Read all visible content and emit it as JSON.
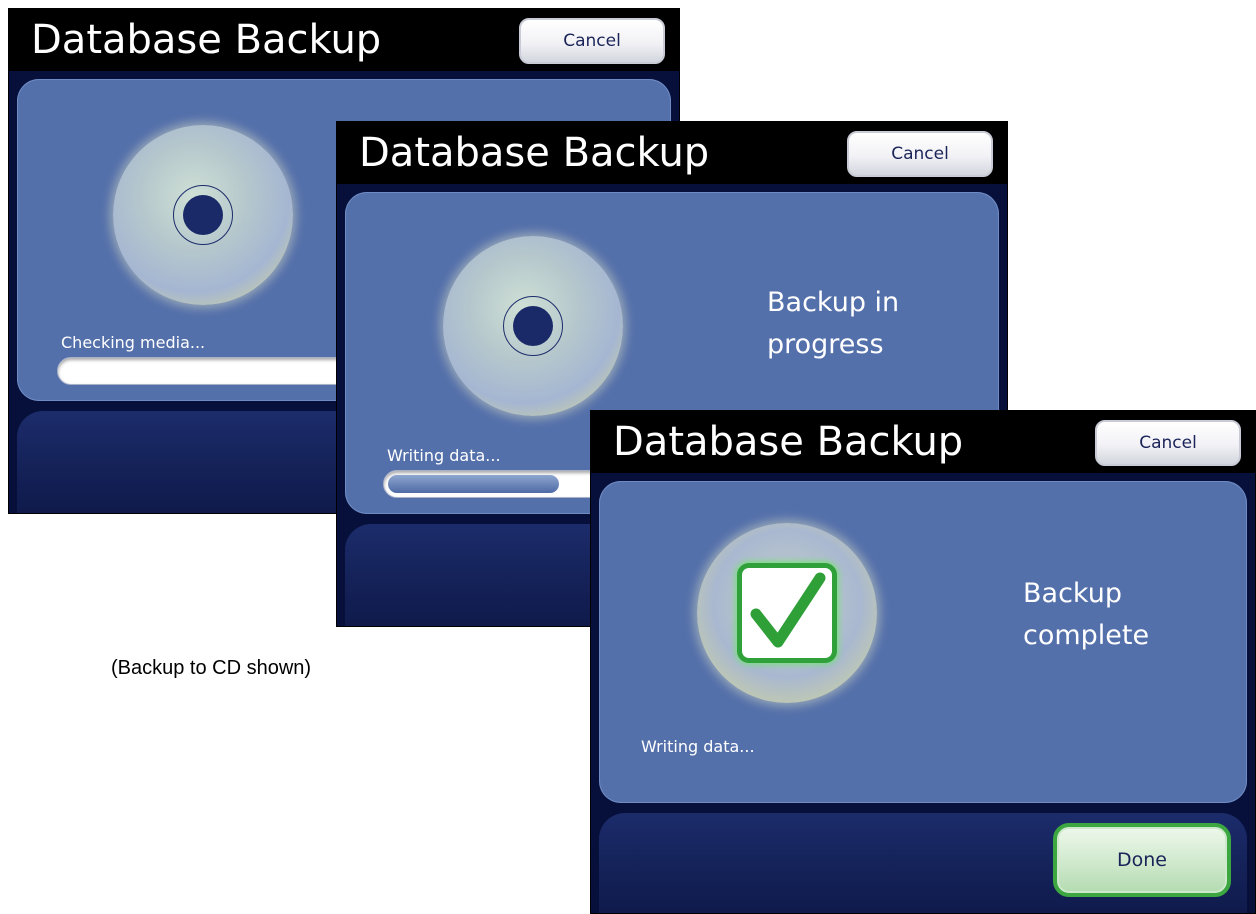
{
  "caption": "(Backup to CD shown)",
  "screens": [
    {
      "title": "Database Backup",
      "cancel_label": "Cancel",
      "status_text": "Checking media...",
      "progress_fraction": 0
    },
    {
      "title": "Database Backup",
      "cancel_label": "Cancel",
      "message_line1": "Backup in",
      "message_line2": "progress",
      "status_text": "Writing data...",
      "progress_fraction": 0.28
    },
    {
      "title": "Database Backup",
      "cancel_label": "Cancel",
      "message_line1": "Backup",
      "message_line2": "complete",
      "status_text": "Writing data...",
      "done_label": "Done"
    }
  ],
  "icons": {
    "disc": "cd-disc-icon",
    "check": "checkmark-icon"
  },
  "colors": {
    "panel": "#5470ab",
    "titlebar": "#000000",
    "check_green": "#2fa03a",
    "done_border": "#3ca640"
  }
}
